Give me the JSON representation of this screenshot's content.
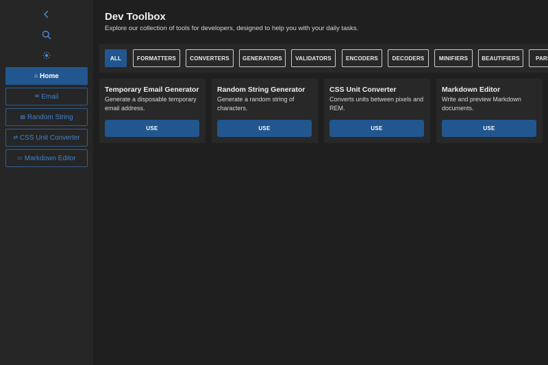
{
  "app": {
    "title": "Dev Toolbox",
    "subtitle": "Explore our collection of tools for developers, designed to help you with your daily tasks."
  },
  "sidebar": {
    "icons": [
      "chevron-left-icon",
      "search-icon",
      "sun-icon"
    ],
    "items": [
      {
        "glyph": "⌂",
        "label": "Home",
        "active": true
      },
      {
        "glyph": "✉",
        "label": "Email",
        "active": false
      },
      {
        "glyph": "▤",
        "label": "Random String",
        "active": false
      },
      {
        "glyph": "⇄",
        "label": "CSS Unit Converter",
        "active": false
      },
      {
        "glyph": "▭",
        "label": "Markdown Editor",
        "active": false
      }
    ]
  },
  "filters": [
    "ALL",
    "FORMATTERS",
    "CONVERTERS",
    "GENERATORS",
    "VALIDATORS",
    "ENCODERS",
    "DECODERS",
    "MINIFIERS",
    "BEAUTIFIERS",
    "PARSERS"
  ],
  "active_filter": "ALL",
  "tools": [
    {
      "title": "Temporary Email Generator",
      "description": "Generate a disposable temporary email address.",
      "button": "USE"
    },
    {
      "title": "Random String Generator",
      "description": "Generate a random string of characters.",
      "button": "USE"
    },
    {
      "title": "CSS Unit Converter",
      "description": "Converts units between pixels and REM.",
      "button": "USE"
    },
    {
      "title": "Markdown Editor",
      "description": "Write and preview Markdown documents.",
      "button": "USE"
    }
  ],
  "colors": {
    "accent": "#22568f",
    "accent_text": "#3f82cf",
    "background": "#1f1f1f",
    "sidebar": "#262626"
  }
}
